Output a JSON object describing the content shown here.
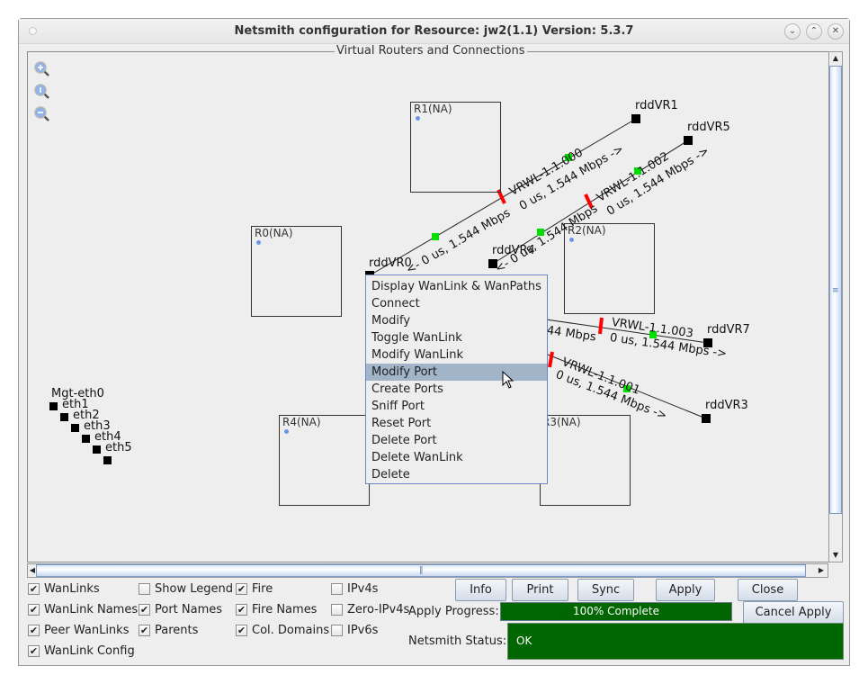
{
  "window": {
    "title": "Netsmith configuration for Resource:  jw2(1.1)  Version: 5.3.7",
    "controls": {
      "minimize": "⌄",
      "maximize": "⌃",
      "close": "✕"
    }
  },
  "panel": {
    "title": "Virtual Routers and Connections",
    "zoom_icons": [
      "zoom-in-icon",
      "zoom-reset-icon",
      "zoom-out-icon"
    ]
  },
  "routers": [
    {
      "name": "R1(NA)"
    },
    {
      "name": "R0(NA)"
    },
    {
      "name": "R2(NA)"
    },
    {
      "name": "R4(NA)"
    },
    {
      "name": "R3(NA)"
    }
  ],
  "ports": {
    "rddVR0": "rddVR0",
    "rddVR1": "rddVR1",
    "rddVR4": "rddVR4",
    "rddVR5": "rddVR5",
    "rddVR7": "rddVR7",
    "rddVR3": "rddVR3"
  },
  "wanlinks": [
    {
      "name": "VRWL-1.1.000",
      "forward": "0 us, 1.544 Mbps ->",
      "reverse": "<- 0 us, 1.544 Mbps"
    },
    {
      "name": "VRWL-1.1.002",
      "forward": "0 us, 1.544 Mbps ->",
      "reverse": "<- 0 us, 1.544 Mbps"
    },
    {
      "name": "VRWL-1.1.003",
      "forward": "0 us, 1.544 Mbps ->",
      "reverse": "44 Mbps"
    },
    {
      "name": "VRWL-1.1.001",
      "forward": "0 us, 1.544 Mbps ->",
      "reverse": ""
    }
  ],
  "mgmt_ports": [
    "Mgt-eth0",
    "eth1",
    "eth2",
    "eth3",
    "eth4",
    "eth5"
  ],
  "context_menu": {
    "items": [
      "Display WanLink & WanPaths",
      "Connect",
      "Modify",
      "Toggle WanLink",
      "Modify WanLink",
      "Modify Port",
      "Create Ports",
      "Sniff Port",
      "Reset Port",
      "Delete Port",
      "Delete WanLink",
      "Delete"
    ],
    "selected": "Modify Port"
  },
  "options": {
    "wanlinks": {
      "label": "WanLinks",
      "checked": true
    },
    "wanlink_names": {
      "label": "WanLink Names",
      "checked": true
    },
    "peer_wanlinks": {
      "label": "Peer WanLinks",
      "checked": true
    },
    "wanlink_config": {
      "label": "WanLink Config",
      "checked": true
    },
    "show_legend": {
      "label": "Show Legend",
      "checked": false
    },
    "port_names": {
      "label": "Port Names",
      "checked": true
    },
    "parents": {
      "label": "Parents",
      "checked": true
    },
    "fire": {
      "label": "Fire",
      "checked": true
    },
    "fire_names": {
      "label": "Fire Names",
      "checked": true
    },
    "col_domains": {
      "label": "Col. Domains",
      "checked": true
    },
    "ipv4s": {
      "label": "IPv4s",
      "checked": false
    },
    "zero_ipv4s": {
      "label": "Zero-IPv4s",
      "checked": false
    },
    "ipv6s": {
      "label": "IPv6s",
      "checked": false
    }
  },
  "buttons": {
    "info": "Info",
    "print": "Print",
    "sync": "Sync",
    "apply": "Apply",
    "close": "Close",
    "cancel_apply": "Cancel Apply"
  },
  "apply_progress": {
    "label": "Apply Progress:",
    "value_percent": 100,
    "text": "100% Complete"
  },
  "netsmith_status": {
    "label": "Netsmith Status:",
    "value": "OK"
  },
  "colors": {
    "status_green": "#006600",
    "port_green": "#00dd00",
    "fire_red": "#ff0000",
    "router_dot": "#6a95ea",
    "menu_selected": "#a2b4c8"
  },
  "check_mark": "✔"
}
